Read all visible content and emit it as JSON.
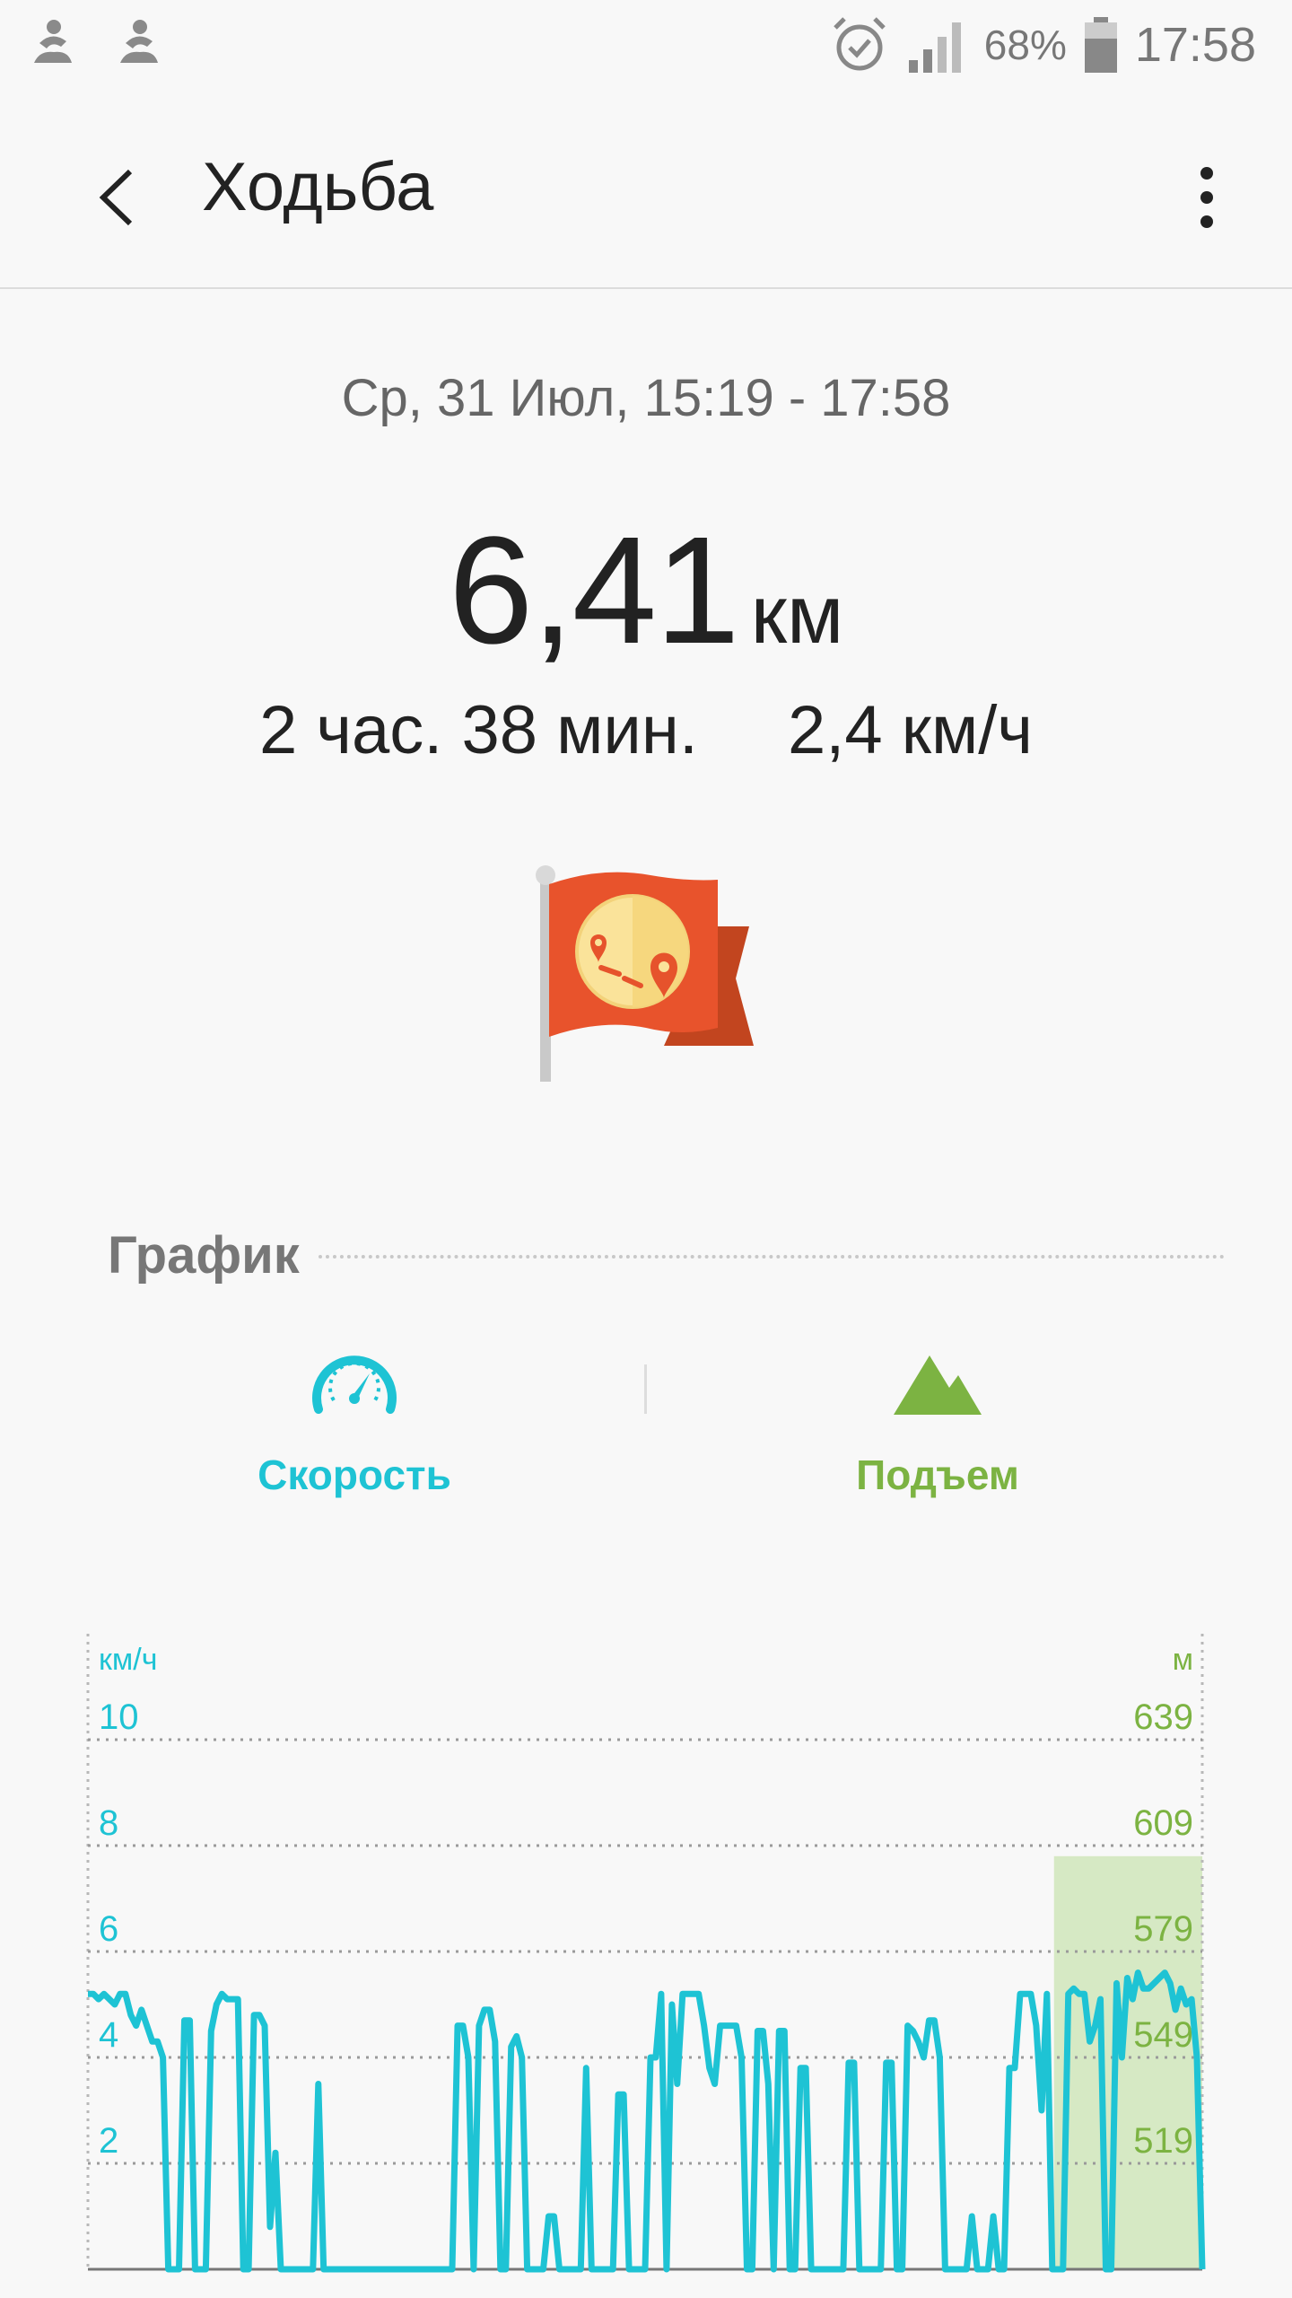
{
  "status_bar": {
    "time": "17:58",
    "battery": "68%",
    "icons": [
      "app-icon",
      "app-icon",
      "alarm-icon",
      "signal-icon",
      "battery-icon"
    ]
  },
  "header": {
    "title": "Ходьба",
    "back_icon": "back-arrow-icon",
    "menu_icon": "more-vert-icon"
  },
  "summary": {
    "date_range": "Ср, 31 Июл, 15:19 - 17:58",
    "distance_value": "6,41",
    "distance_unit": "км",
    "duration": "2 час. 38 мин.",
    "avg_speed": "2,4 км/ч",
    "badge_icon": "route-flag-icon"
  },
  "graph": {
    "section_title": "График",
    "tabs": [
      {
        "label": "Скорость",
        "icon": "speedometer-icon",
        "color": "#1ec3d4"
      },
      {
        "label": "Подъем",
        "icon": "mountain-icon",
        "color": "#7cb342"
      }
    ]
  },
  "chart_data": {
    "type": "line",
    "left_axis_unit": "км/ч",
    "right_axis_unit": "м",
    "left_ticks": [
      "10",
      "8",
      "6",
      "4",
      "2"
    ],
    "right_ticks": [
      "639",
      "609",
      "579",
      "549",
      "519"
    ],
    "ylim_left": [
      0,
      10
    ],
    "ylim_right": [
      489,
      639
    ],
    "grid": true,
    "series": [
      {
        "color": "#1ec3d4",
        "values": [
          5.2,
          5.2,
          5.1,
          5.2,
          5.1,
          5.0,
          5.2,
          5.2,
          4.8,
          4.6,
          4.9,
          4.6,
          4.3,
          4.3,
          4.0,
          0,
          0,
          0,
          4.7,
          4.7,
          0,
          0,
          0,
          4.5,
          5.0,
          5.2,
          5.1,
          5.1,
          5.1,
          0,
          0,
          4.8,
          4.8,
          4.6,
          0.8,
          2.2,
          0,
          0,
          0,
          0,
          0,
          0,
          0,
          3.5,
          0,
          0,
          0,
          0,
          0,
          0,
          0,
          0,
          0,
          0,
          0,
          0,
          0,
          0,
          0,
          0,
          0,
          0,
          0,
          0,
          0,
          0,
          0,
          0,
          0,
          4.6,
          4.6,
          4.0,
          0,
          4.6,
          4.9,
          4.9,
          4.3,
          0,
          0,
          4.2,
          4.4,
          4.0,
          0,
          0,
          0,
          0,
          1.0,
          1.0,
          0,
          0,
          0,
          0,
          0,
          3.8,
          0,
          0,
          0,
          0,
          0,
          3.3,
          3.3,
          0,
          0,
          0,
          0,
          4.0,
          4.0,
          5.2,
          0,
          5.0,
          3.5,
          5.2,
          5.2,
          5.2,
          5.2,
          4.6,
          3.8,
          3.5,
          4.6,
          4.6,
          4.6,
          4.6,
          4.0,
          0,
          0,
          4.5,
          4.5,
          3.5,
          0,
          4.5,
          4.5,
          0,
          0,
          3.8,
          3.8,
          0,
          0,
          0,
          0,
          0,
          0,
          0,
          3.9,
          3.9,
          0,
          0,
          0,
          0,
          0,
          3.9,
          3.9,
          0,
          0,
          4.6,
          4.5,
          4.3,
          4.0,
          4.7,
          4.7,
          4.0,
          0,
          0,
          0,
          0,
          0,
          1.0,
          0,
          0,
          0,
          1.0,
          0,
          0,
          3.8,
          3.8,
          5.2,
          5.2,
          5.2,
          4.6,
          3.0,
          5.2,
          0,
          0,
          0,
          5.2,
          5.3,
          5.2,
          5.2,
          4.3,
          4.6,
          5.1,
          0,
          0,
          5.4,
          4.0,
          5.5,
          5.1,
          5.6,
          5.3,
          5.3,
          5.4,
          5.5,
          5.6,
          5.4,
          4.9,
          5.3,
          5.0,
          5.1,
          4.0,
          0
        ]
      }
    ],
    "highlight_region": {
      "from_fraction": 0.875,
      "to_fraction": 1.0,
      "color": "#d6e9c4"
    }
  }
}
